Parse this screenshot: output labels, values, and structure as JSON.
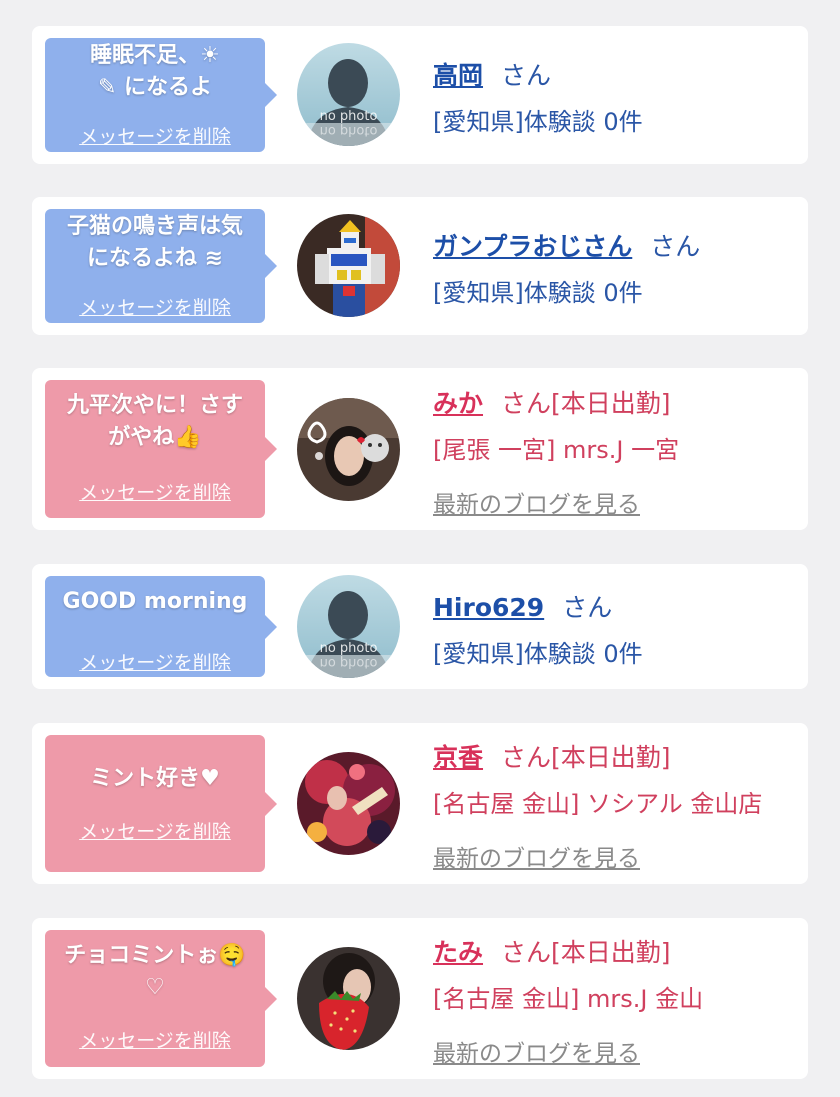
{
  "delete_label": "メッセージを削除",
  "no_photo_label": "no photo",
  "san_suffix": "さん",
  "blog_label": "最新のブログを見る",
  "colors": {
    "blue_bubble": "#8fb0ec",
    "pink_bubble": "#ee9aa9",
    "blue_text": "#2a56a6",
    "pink_text": "#d0405e"
  },
  "messages": [
    {
      "bubble_line1": "睡眠不足、☀",
      "bubble_line2": "✎ になるよ",
      "name": "高岡",
      "suffix": "さん",
      "detail": "[愛知県]体験談 0件",
      "avatar": "no-photo"
    },
    {
      "bubble_line1": "子猫の鳴き声は気",
      "bubble_line2": "になるよね ≋",
      "name": "ガンプラおじさん",
      "suffix": "さん",
      "detail": "[愛知県]体験談 0件",
      "avatar": "robot-photo"
    },
    {
      "bubble_line1": "九平次やに！さす",
      "bubble_line2": "がやね👍",
      "name": "みか",
      "suffix": "さん[本日出勤]",
      "detail": "[尾張 一宮] mrs.J 一宮",
      "avatar": "selfie-photo"
    },
    {
      "bubble_line1": "GOOD morning",
      "name": "Hiro629",
      "suffix": "さん",
      "detail": "[愛知県]体験談 0件",
      "avatar": "no-photo"
    },
    {
      "bubble_line1": "ミント好き♥",
      "name": "京香",
      "suffix": "さん[本日出勤]",
      "detail": "[名古屋 金山] ソシアル 金山店",
      "avatar": "kimono-photo"
    },
    {
      "bubble_line1": "チョコミントぉ🤤",
      "bubble_line2": "♡",
      "name": "たみ",
      "suffix": "さん[本日出勤]",
      "detail": "[名古屋 金山] mrs.J 金山",
      "avatar": "strawberry-photo"
    }
  ]
}
